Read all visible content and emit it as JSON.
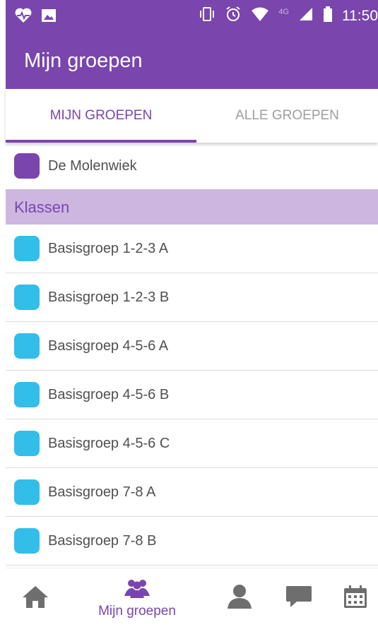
{
  "status_bar": {
    "time": "11:50",
    "network": "4G"
  },
  "app_bar": {
    "title": "Mijn groepen"
  },
  "tabs": [
    {
      "label": "MIJN GROEPEN",
      "active": true
    },
    {
      "label": "ALLE GROEPEN",
      "active": false
    }
  ],
  "top_group": {
    "label": "De Molenwiek",
    "color": "#7a45ad"
  },
  "section": {
    "title": "Klassen"
  },
  "groups": [
    {
      "label": "Basisgroep 1-2-3 A",
      "color": "#33bde9"
    },
    {
      "label": "Basisgroep 1-2-3 B",
      "color": "#33bde9"
    },
    {
      "label": "Basisgroep 4-5-6 A",
      "color": "#33bde9"
    },
    {
      "label": "Basisgroep 4-5-6 B",
      "color": "#33bde9"
    },
    {
      "label": "Basisgroep 4-5-6 C",
      "color": "#33bde9"
    },
    {
      "label": "Basisgroep 7-8 A",
      "color": "#33bde9"
    },
    {
      "label": "Basisgroep 7-8 B",
      "color": "#33bde9"
    }
  ],
  "bottom_nav": {
    "items": [
      {
        "icon": "home-icon",
        "label": "",
        "active": false
      },
      {
        "icon": "groups-icon",
        "label": "Mijn groepen",
        "active": true
      },
      {
        "icon": "person-icon",
        "label": "",
        "active": false
      },
      {
        "icon": "chat-icon",
        "label": "",
        "active": false
      },
      {
        "icon": "calendar-icon",
        "label": "",
        "active": false
      }
    ]
  },
  "colors": {
    "primary": "#7a45ad",
    "section_bg": "#cdb7e0",
    "group_swatch": "#33bde9",
    "inactive_icon": "#6e6e6e"
  }
}
